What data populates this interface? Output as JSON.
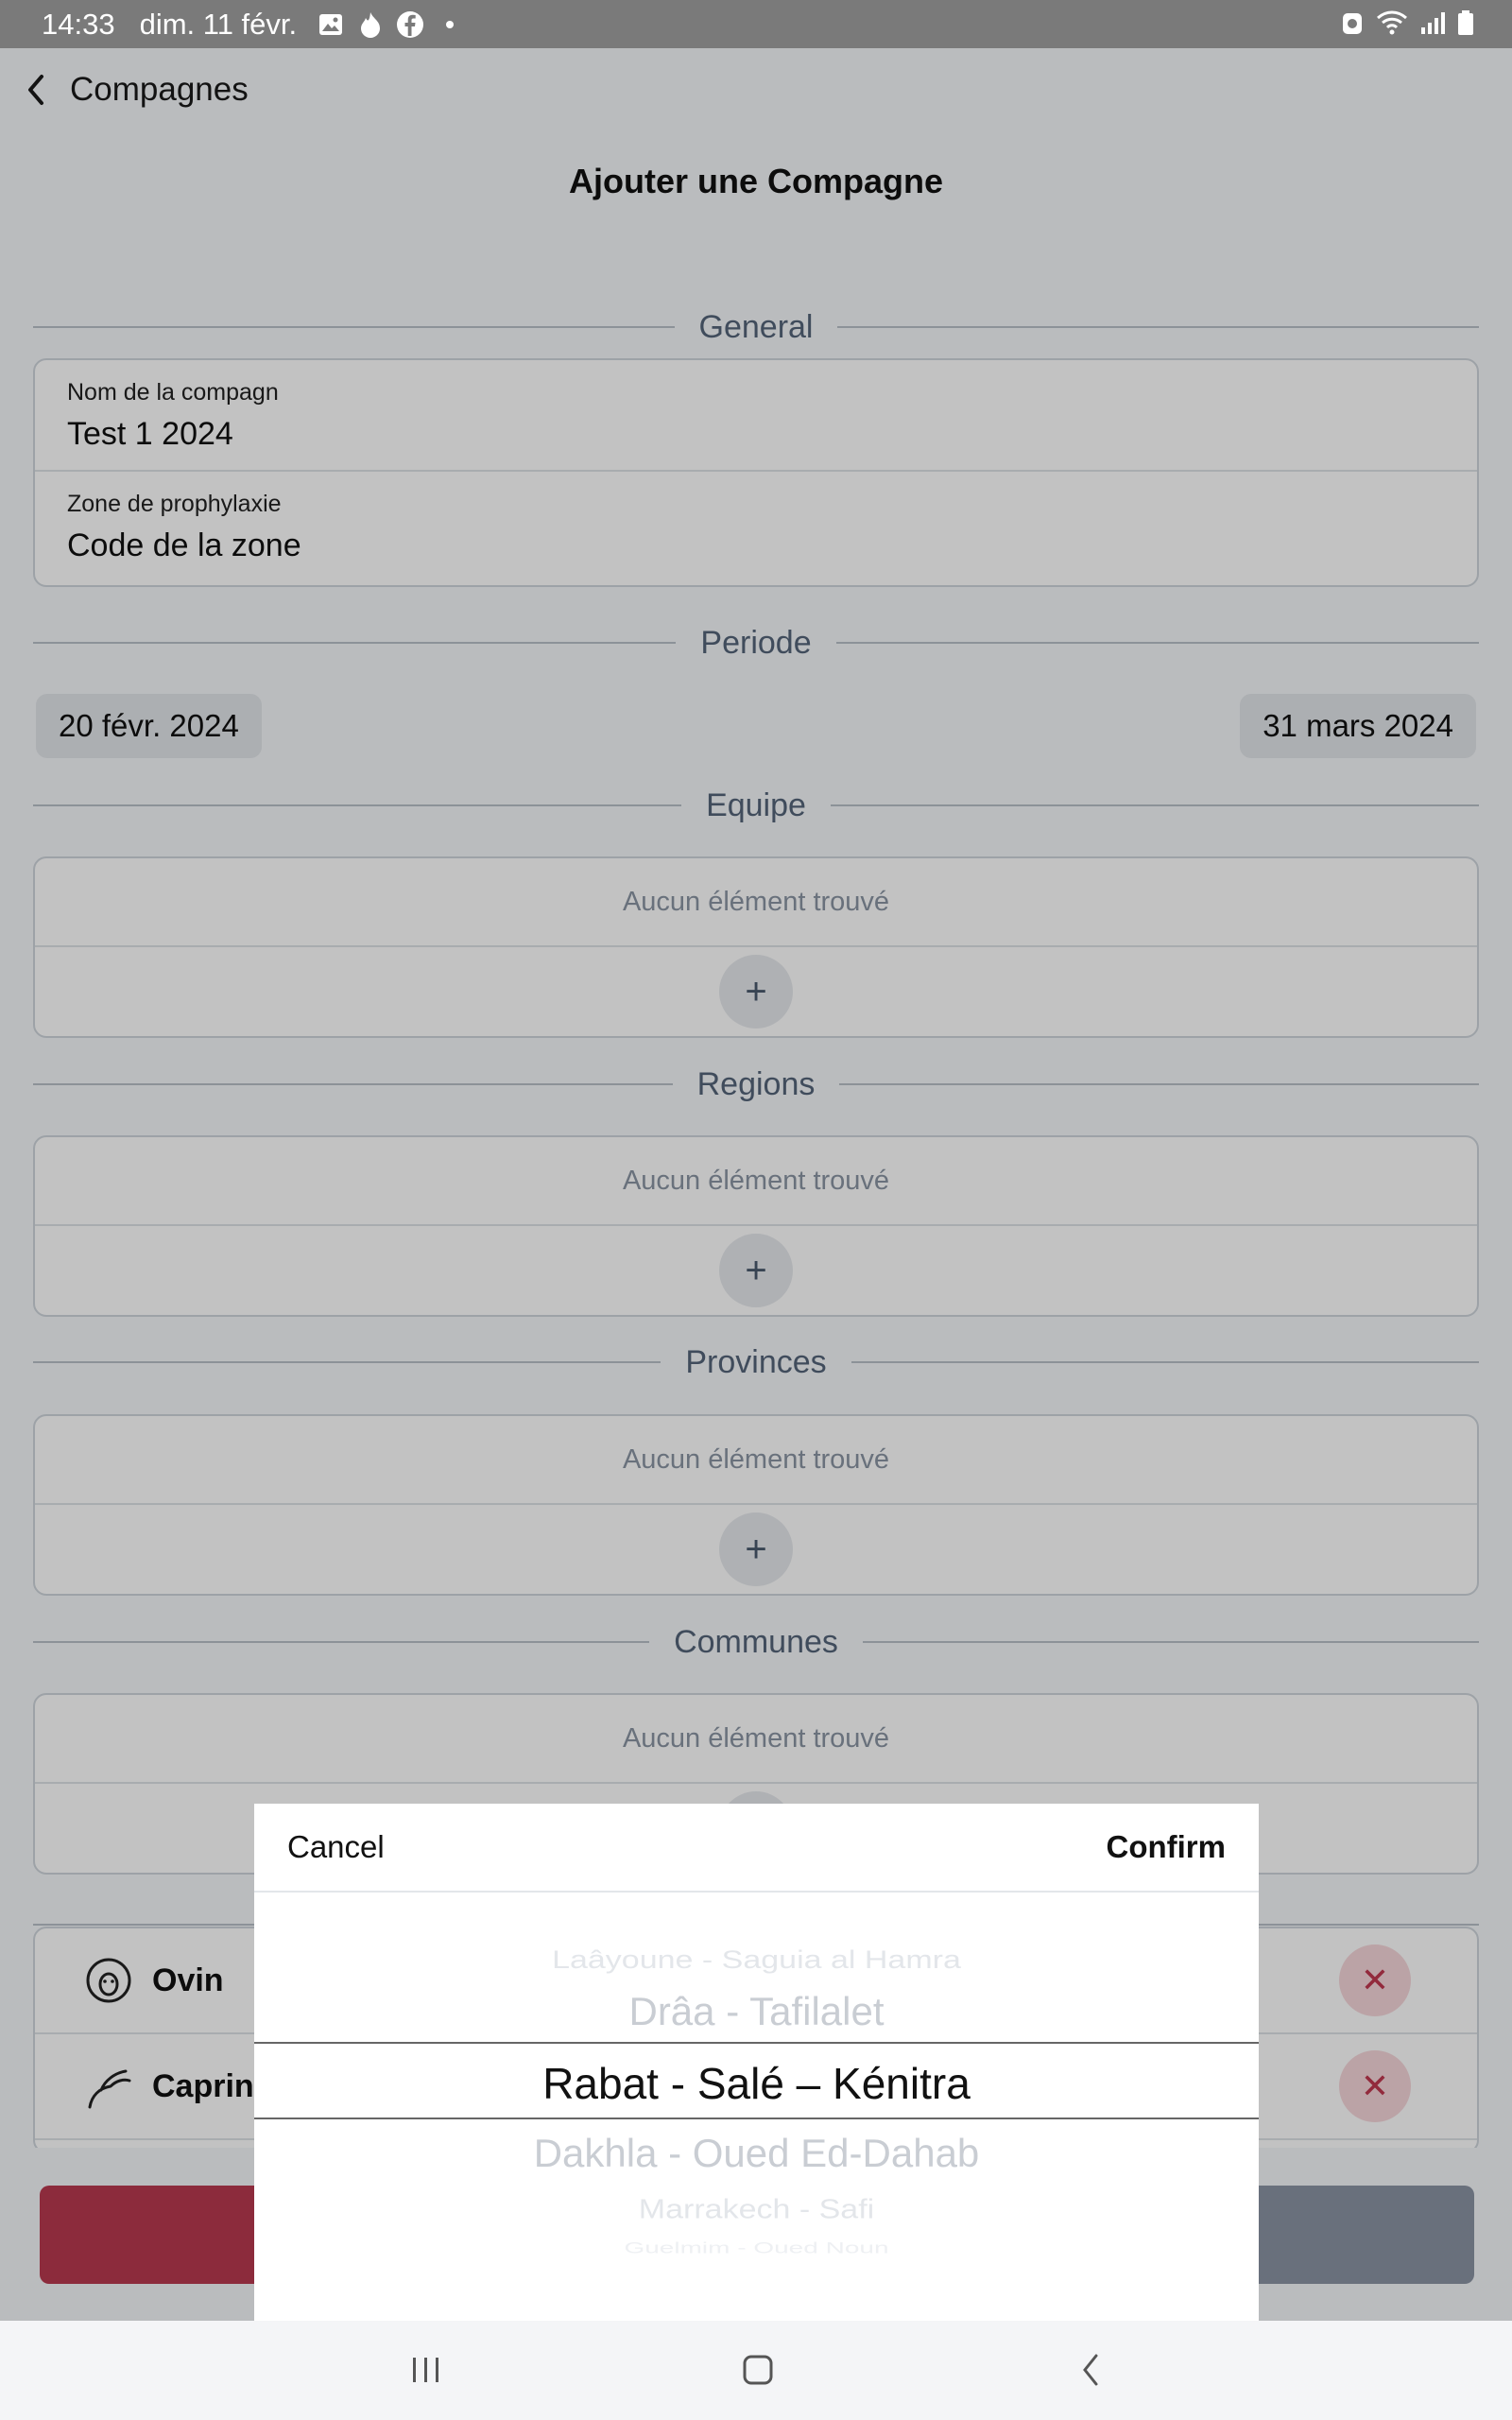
{
  "status_bar": {
    "time": "14:33",
    "date": "dim. 11 févr.",
    "icons_left": [
      "gallery-icon",
      "flame-icon",
      "facebook-icon",
      "dot-icon"
    ],
    "icons_right": [
      "alarm-icon",
      "wifi-icon",
      "signal-icon",
      "battery-icon"
    ]
  },
  "nav": {
    "back_label": "Compagnes"
  },
  "page_title": "Ajouter une Compagne",
  "sections": {
    "general": "General",
    "periode": "Periode",
    "equipe": "Equipe",
    "regions": "Regions",
    "provinces": "Provinces",
    "communes": "Communes"
  },
  "general": {
    "name_label": "Nom de la compagn",
    "name_value": "Test 1 2024",
    "zone_label": "Zone de prophylaxie",
    "zone_value": "Code de la zone"
  },
  "periode": {
    "start": "20 févr. 2024",
    "end": "31 mars 2024"
  },
  "empty_text": "Aucun élément trouvé",
  "add_symbol": "+",
  "species": [
    {
      "name": "Ovin",
      "icon": "sheep-icon"
    },
    {
      "name": "Caprin",
      "icon": "goat-icon"
    }
  ],
  "remove_symbol": "✕",
  "picker": {
    "cancel": "Cancel",
    "confirm": "Confirm",
    "items": [
      "Laâyoune - Saguia al Hamra",
      "Drâa - Tafilalet",
      "Rabat - Salé – Kénitra",
      "Dakhla - Oued Ed-Dahab",
      "Marrakech - Safi",
      "Guelmim - Oued Noun"
    ],
    "selected": "Rabat - Salé – Kénitra"
  },
  "colors": {
    "danger": "#b93950",
    "secondary": "#8b94a4",
    "section_text": "#55657a"
  }
}
